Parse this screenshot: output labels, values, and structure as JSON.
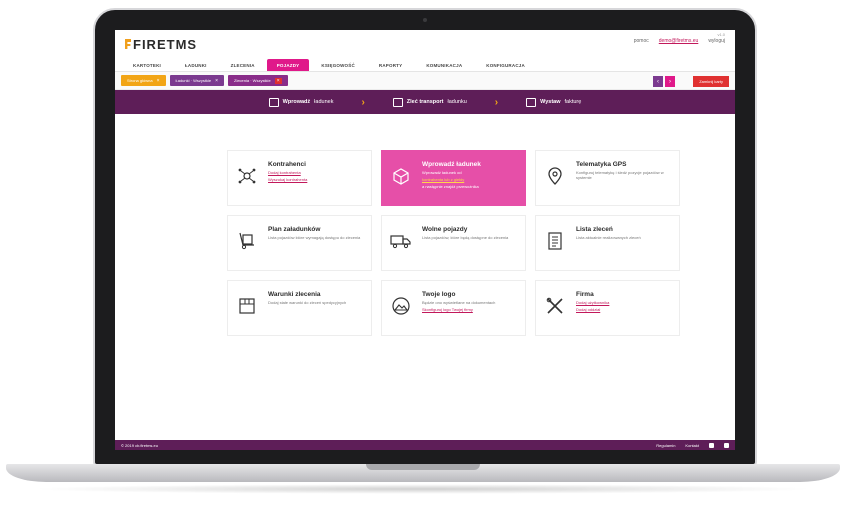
{
  "app": {
    "logo_fire": "FIRE",
    "logo_tms": "TMS",
    "version": "v1.0",
    "user_links": [
      "pomoc",
      "demo@firetms.eu",
      "wyloguj"
    ]
  },
  "menu": [
    "KARTOTEKI",
    "ŁADUNKI",
    "ZLECENIA",
    "POJAZDY",
    "KSIĘGOWOŚĆ",
    "RAPORTY",
    "KOMUNIKACJA",
    "KONFIGURACJA"
  ],
  "menu_active_index": 3,
  "tabs": [
    {
      "label": "Strona główna",
      "color": "orange"
    },
    {
      "label": "Ładunki · Wszystkie",
      "color": "purple"
    },
    {
      "label": "Zlecenia · Wszystkie",
      "color": "purple2"
    }
  ],
  "tab_close": "×",
  "close_all_label": "Zamknij karty",
  "nav_prev": "‹",
  "nav_next": "›",
  "actions": [
    {
      "bold": "Wprowadź",
      "rest": "ładunek"
    },
    {
      "bold": "Zleć transport",
      "rest": "ładunku"
    },
    {
      "bold": "Wystaw",
      "rest": "fakturę"
    }
  ],
  "chevron": "›",
  "tiles": [
    {
      "title": "Kontrahenci",
      "desc": "",
      "links": [
        "Dodaj kontrahenta",
        "Wyszukaj kontrahenta"
      ],
      "icon": "network-icon"
    },
    {
      "title": "Wprowadź ładunek",
      "desc": "Wprowadź ładunek od",
      "links": [
        "kontrahenta lub z giełdy"
      ],
      "desc2": "a następnie znajdź przewoźnika",
      "icon": "box-icon",
      "active": true
    },
    {
      "title": "Telematyka GPS",
      "desc": "Konfiguruj telematykę i śledź pozycje pojazdów w systemie",
      "links": [],
      "icon": "location-pin-icon"
    },
    {
      "title": "Plan załadunków",
      "desc": "Lista pojazdów które wymagają dostępu do zlecenia",
      "links": [],
      "icon": "hand-truck-icon"
    },
    {
      "title": "Wolne pojazdy",
      "desc": "Lista pojazdów, które będą dostępne do zlecenia",
      "links": [],
      "icon": "truck-icon"
    },
    {
      "title": "Lista zleceń",
      "desc": "Lista aktualnie realizowanych zleceń",
      "links": [],
      "icon": "list-icon"
    },
    {
      "title": "Warunki zlecenia",
      "desc": "Dodaj stałe warunki do zleceń spedycyjnych",
      "links": [],
      "icon": "document-box-icon"
    },
    {
      "title": "Twoje logo",
      "desc": "Będzie ono wyświetlane na dokumentach",
      "links": [
        "Skonfiguruj logo Twojej firmy"
      ],
      "icon": "logo-mountain-icon"
    },
    {
      "title": "Firma",
      "desc": "",
      "links": [
        "Dodaj użytkownika",
        "Dodaj oddział"
      ],
      "icon": "tools-icon"
    }
  ],
  "footer": {
    "copyright": "© 2019 cb.firetms.eu",
    "links": [
      "Regulamin",
      "Kontakt"
    ]
  },
  "colors": {
    "accent_pink": "#e0198a",
    "purple_dark": "#5e1e58",
    "orange": "#f2a516",
    "red": "#e03131"
  }
}
